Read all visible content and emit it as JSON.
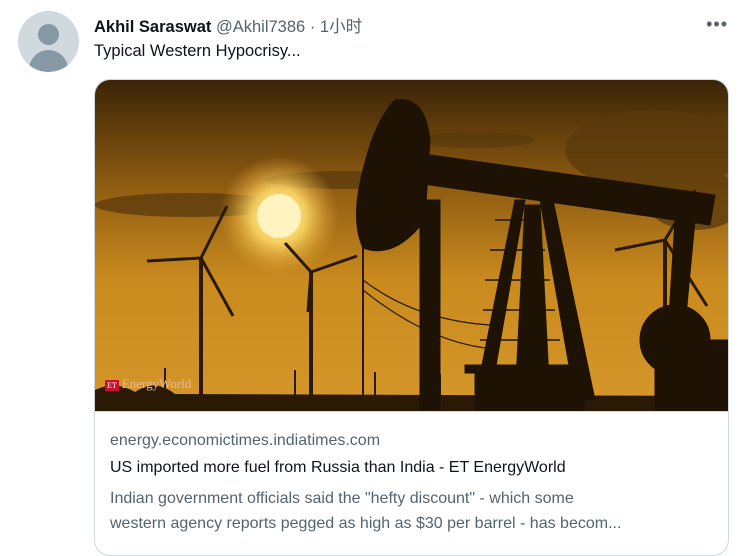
{
  "tweet": {
    "display_name": "Akhil Saraswat",
    "handle": "@Akhil7386",
    "separator": "·",
    "time": "1小时",
    "more_label": "•••",
    "text": "Typical Western Hypocrisy..."
  },
  "card": {
    "image_watermark": "EnergyWorld",
    "image_watermark_badge": "ET",
    "domain": "energy.economictimes.indiatimes.com",
    "title": "US imported more fuel from Russia than India - ET EnergyWorld",
    "description_line1": "Indian government officials said the \"hefty discount\" - which some",
    "description_line2": "western agency reports pegged as high as $30 per barrel - has becom..."
  },
  "colors": {
    "text_primary": "#0f1419",
    "text_secondary": "#536471",
    "border": "#cfd9de",
    "sky_top": "#3a2407",
    "sky_mid": "#c98a1e",
    "sun": "#fff4c0"
  },
  "icons": {
    "avatar": "default-user-avatar-icon",
    "more": "more-horizontal-icon"
  }
}
